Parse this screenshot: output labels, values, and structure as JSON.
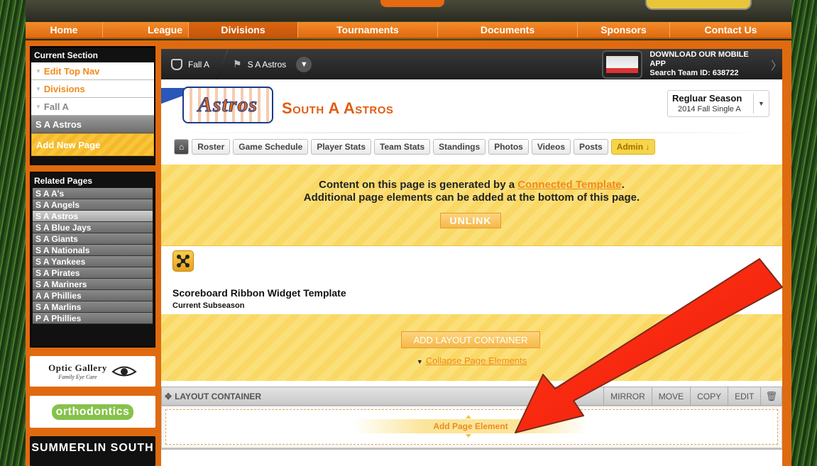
{
  "nav": {
    "items": [
      "Home",
      "League",
      "Divisions",
      "Tournaments",
      "Documents",
      "Sponsors",
      "Contact Us"
    ],
    "active": "Divisions"
  },
  "sidebar": {
    "current_section_title": "Current Section",
    "current_items": [
      {
        "label": "Edit Top Nav",
        "style": "orange"
      },
      {
        "label": "Divisions",
        "style": "orange"
      },
      {
        "label": "Fall A",
        "style": "grey"
      },
      {
        "label": "S A Astros",
        "style": "selected"
      },
      {
        "label": "Add New Page",
        "style": "add"
      }
    ],
    "related_title": "Related Pages",
    "related_items": [
      "S A A's",
      "S A Angels",
      "S A Astros",
      "S A Blue Jays",
      "S A Giants",
      "S A Nationals",
      "S A Yankees",
      "S A Pirates",
      "S A Mariners",
      "A A Phillies",
      "S A Marlins",
      "P A Phillies"
    ],
    "related_active": "S A Astros"
  },
  "ads": {
    "optic_title": "Optic Gallery",
    "optic_sub": "Family Eye Care",
    "ortho": "orthodontics",
    "summerlin": "SUMMERLIN SOUTH"
  },
  "breadcrumb": {
    "level1": "Fall A",
    "level2": "S A Astros"
  },
  "app_promo": {
    "line1": "DOWNLOAD OUR MOBILE APP",
    "line2": "Search Team ID: 638722"
  },
  "team": {
    "logo_text": "Astros",
    "name": "South A Astros",
    "season_title": "Regluar Season",
    "season_sub": "2014 Fall Single A"
  },
  "tabs": [
    "Roster",
    "Game Schedule",
    "Player Stats",
    "Team Stats",
    "Standings",
    "Photos",
    "Videos",
    "Posts",
    "Admin ↓"
  ],
  "banner": {
    "line1_pre": "Content on this page is generated by a ",
    "line1_link": "Connected Template",
    "line1_post": ".",
    "line2": "Additional page elements can be added at the bottom of this page.",
    "unlink": "UNLINK"
  },
  "widget": {
    "title": "Scoreboard Ribbon Widget Template",
    "subtitle": "Current Subseason"
  },
  "layout": {
    "add_container": "ADD LAYOUT CONTAINER",
    "collapse": "Collapse Page Elements",
    "container_title": "LAYOUT CONTAINER",
    "actions": [
      "MIRROR",
      "MOVE",
      "COPY",
      "EDIT"
    ],
    "add_element": "Add Page Element"
  },
  "colors": {
    "accent_orange": "#e06a10",
    "highlight_yellow": "#fbe07a",
    "annotation_red": "#ff2a10"
  }
}
